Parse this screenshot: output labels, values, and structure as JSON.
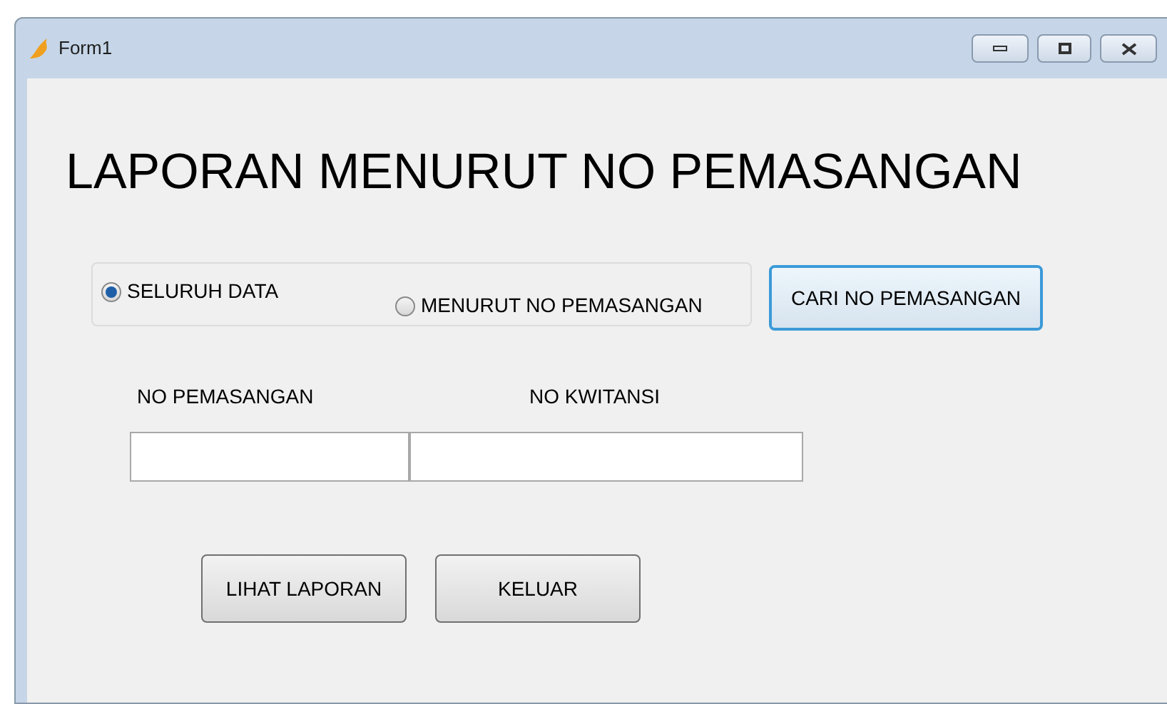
{
  "window": {
    "title": "Form1"
  },
  "heading": "LAPORAN MENURUT NO PEMASANGAN",
  "radios": [
    {
      "label": "SELURUH DATA",
      "selected": true
    },
    {
      "label": "MENURUT NO PEMASANGAN",
      "selected": false
    }
  ],
  "search_button": "CARI NO PEMASANGAN",
  "fields": [
    {
      "label": "NO PEMASANGAN"
    },
    {
      "label": "NO KWITANSI"
    }
  ],
  "buttons": [
    "LIHAT LAPORAN",
    "KELUAR"
  ]
}
